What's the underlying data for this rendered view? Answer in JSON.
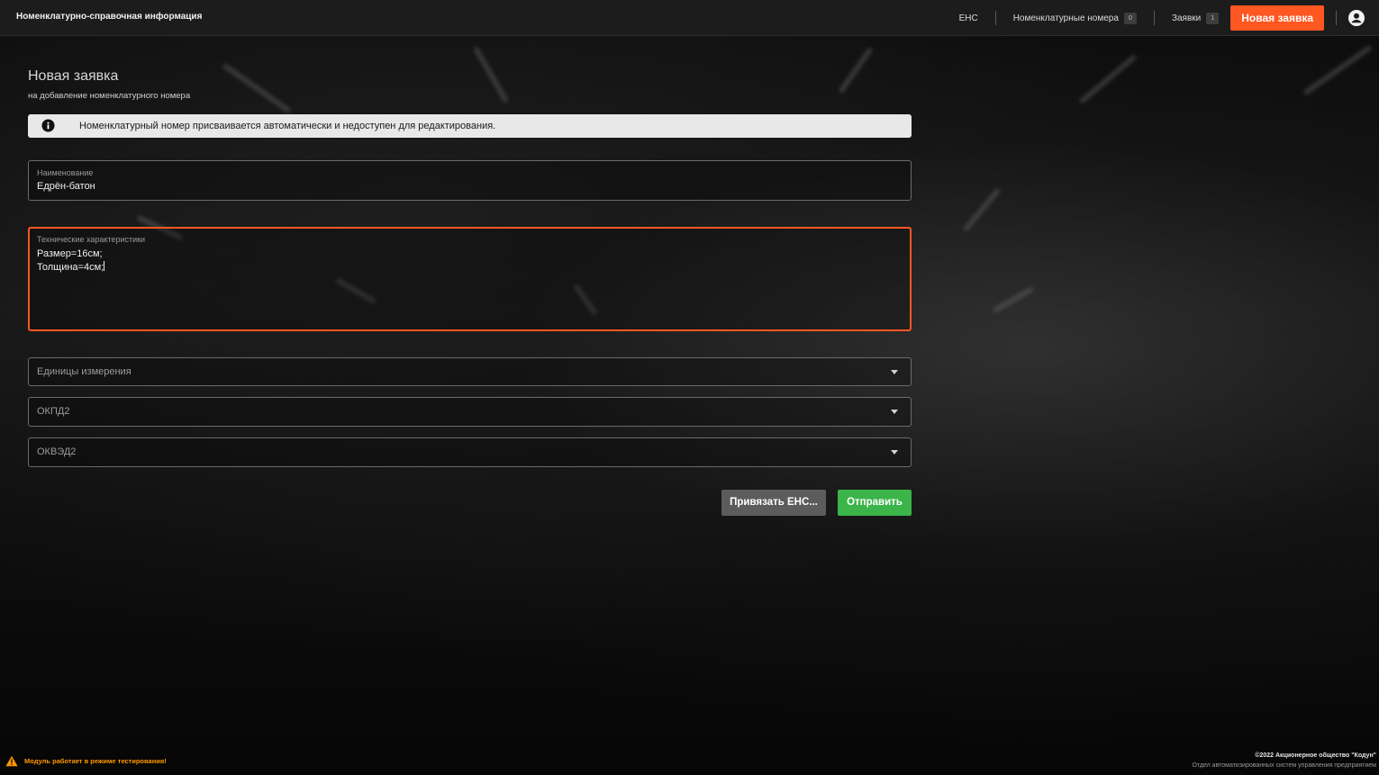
{
  "header": {
    "app_title": "Номенклатурно-справочная информация",
    "nav": {
      "ens": "ЕНС",
      "nomenclature_numbers": "Номенклатурные номера",
      "nomenclature_numbers_count": "0",
      "requests": "Заявки",
      "requests_count": "1",
      "new_request": "Новая заявка"
    }
  },
  "page": {
    "title": "Новая заявка",
    "subtitle": "на добавление номенклатурного номера"
  },
  "alert": {
    "text": "Номенклатурный номер присваивается автоматически и недоступен для редактирования."
  },
  "form": {
    "name": {
      "label": "Наименование",
      "value": "Едрён-батон"
    },
    "specs": {
      "label": "Технические характеристики",
      "line1": "Размер=16см;",
      "line2": "Толщина=4см;"
    },
    "units": {
      "placeholder": "Единицы измерения"
    },
    "okpd2": {
      "placeholder": "ОКПД2"
    },
    "okved2": {
      "placeholder": "ОКВЭД2"
    }
  },
  "actions": {
    "bind": "Привязать ЕНС...",
    "send": "Отправить"
  },
  "footer": {
    "warning": "Модуль работает в режиме тестирования!",
    "copyright": "©2022 Акционерное общество \"Кодун\"",
    "department": "Отдел автоматизированных систем управления предприятием"
  },
  "colors": {
    "accent": "#ff5722",
    "success": "#3bb44a",
    "warning": "#ff9800"
  }
}
